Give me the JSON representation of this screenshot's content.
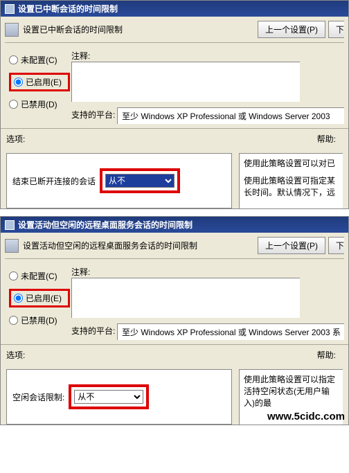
{
  "window1": {
    "title": "设置已中断会话的时间限制",
    "heading": "设置已中断会话的时间限制",
    "prev_button": "上一个设置(P)",
    "next_button_partial": "下",
    "radio_not_configured": "未配置(C)",
    "radio_enabled": "已启用(E)",
    "radio_disabled": "已禁用(D)",
    "comment_label": "注释:",
    "platform_label": "支持的平台:",
    "platform_value": "至少 Windows XP Professional 或 Windows Server 2003",
    "selection_label": "选项:",
    "help_label": "帮助:",
    "end_disconnect_label": "结束已断开连接的会话",
    "combo_value": "从不",
    "help_text1": "使用此策略设置可以对已",
    "help_text2": "使用此策略设置可指定某长时间。默认情况下，远"
  },
  "window2": {
    "title": "设置活动但空闲的远程桌面服务会话的时间限制",
    "heading": "设置活动但空闲的远程桌面服务会话的时间限制",
    "prev_button": "上一个设置(P)",
    "next_button_partial": "下",
    "radio_not_configured": "未配置(C)",
    "radio_enabled": "已启用(E)",
    "radio_disabled": "已禁用(D)",
    "comment_label": "注释:",
    "platform_label": "支持的平台:",
    "platform_value": "至少 Windows XP Professional 或 Windows Server 2003 系",
    "selection_label": "选项:",
    "help_label": "帮助:",
    "idle_limit_label": "空闲会话限制:",
    "combo_value": "从不",
    "help_text": "使用此策略设置可以指定活持空闲状态(无用户输入)的最"
  },
  "watermark": "www.5cidc.com"
}
